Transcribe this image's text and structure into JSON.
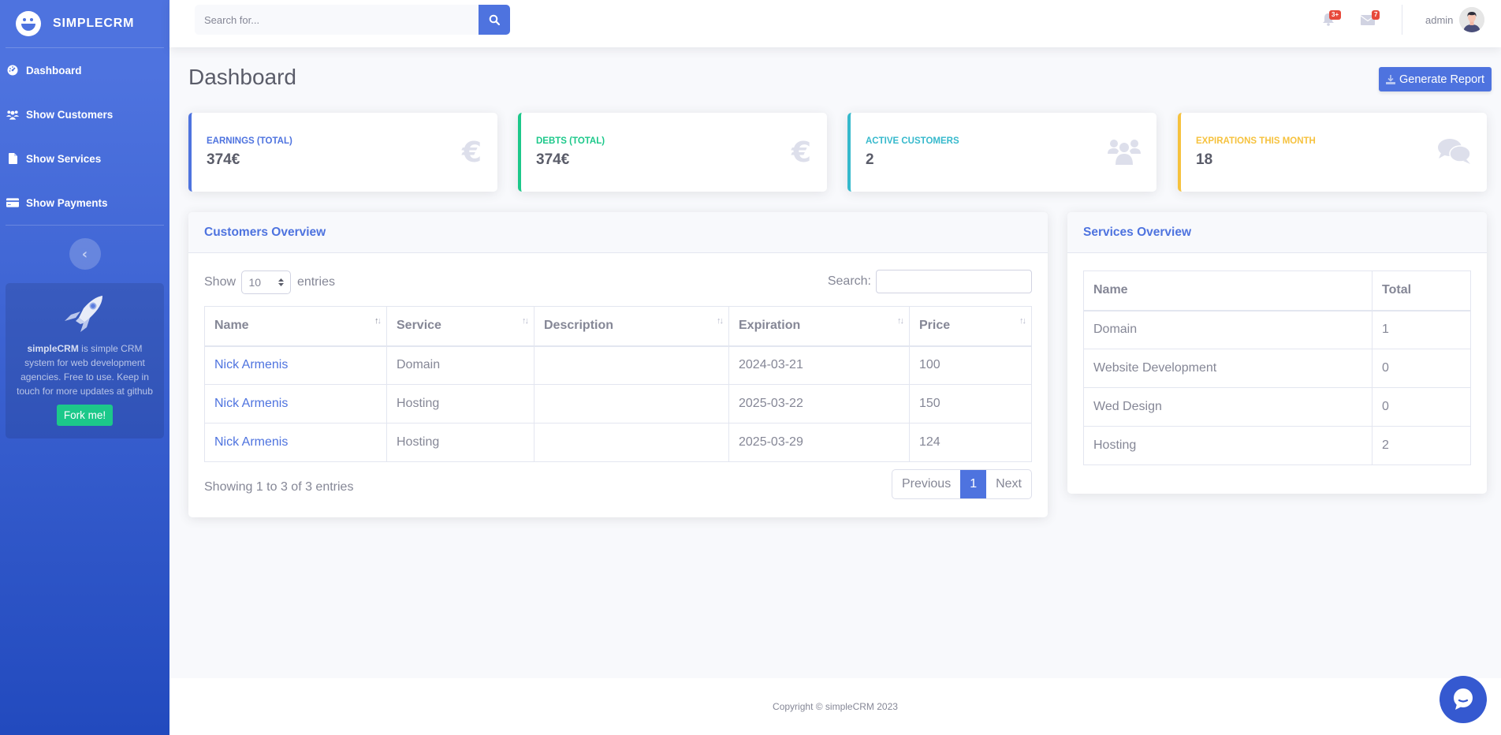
{
  "brand": {
    "name": "SIMPLECRM"
  },
  "sidebar": {
    "items": [
      {
        "label": "Dashboard",
        "icon": "tachometer-icon"
      },
      {
        "label": "Show Customers",
        "icon": "users-icon"
      },
      {
        "label": "Show Services",
        "icon": "file-icon"
      },
      {
        "label": "Show Payments",
        "icon": "credit-card-icon"
      }
    ],
    "toggle_glyph": "‹",
    "promo": {
      "brand": "simpleCRM",
      "text": " is simple CRM system for web development agencies. Free to use. Keep in touch for more updates at github",
      "button_label": "Fork me!"
    }
  },
  "topbar": {
    "search_placeholder": "Search for...",
    "alerts_badge": "3+",
    "messages_badge": "7",
    "user_name": "admin"
  },
  "page": {
    "title": "Dashboard",
    "report_button": "Generate Report"
  },
  "stats": [
    {
      "label": "Earnings (Total)",
      "value": "374€",
      "color": "#4e73df",
      "icon": "€"
    },
    {
      "label": "Debts (Total)",
      "value": "374€",
      "color": "#1cc88a",
      "icon": "€"
    },
    {
      "label": "Active Customers",
      "value": "2",
      "color": "#36b9cc",
      "icon": "users"
    },
    {
      "label": "Expirations This Month",
      "value": "18",
      "color": "#f6c23e",
      "icon": "comments"
    }
  ],
  "customers": {
    "title": "Customers Overview",
    "show_label": "Show",
    "entries_label": "entries",
    "page_length": "10",
    "search_label": "Search:",
    "search_value": "",
    "columns": [
      "Name",
      "Service",
      "Description",
      "Expiration",
      "Price"
    ],
    "rows": [
      [
        "Nick Armenis",
        "Domain",
        "",
        "2024-03-21",
        "100"
      ],
      [
        "Nick Armenis",
        "Hosting",
        "",
        "2025-03-22",
        "150"
      ],
      [
        "Nick Armenis",
        "Hosting",
        "",
        "2025-03-29",
        "124"
      ]
    ],
    "info": "Showing 1 to 3 of 3 entries",
    "pager": {
      "previous": "Previous",
      "current": "1",
      "next": "Next"
    }
  },
  "services": {
    "title": "Services Overview",
    "columns": [
      "Name",
      "Total"
    ],
    "rows": [
      [
        "Domain",
        "1"
      ],
      [
        "Website Development",
        "0"
      ],
      [
        "Wed Design",
        "0"
      ],
      [
        "Hosting",
        "2"
      ]
    ]
  },
  "footer": {
    "text": "Copyright © simpleCRM 2023"
  },
  "colors": {
    "primary": "#4e73df",
    "success": "#1cc88a",
    "info": "#36b9cc",
    "warning": "#f6c23e",
    "danger": "#e74a3b"
  }
}
